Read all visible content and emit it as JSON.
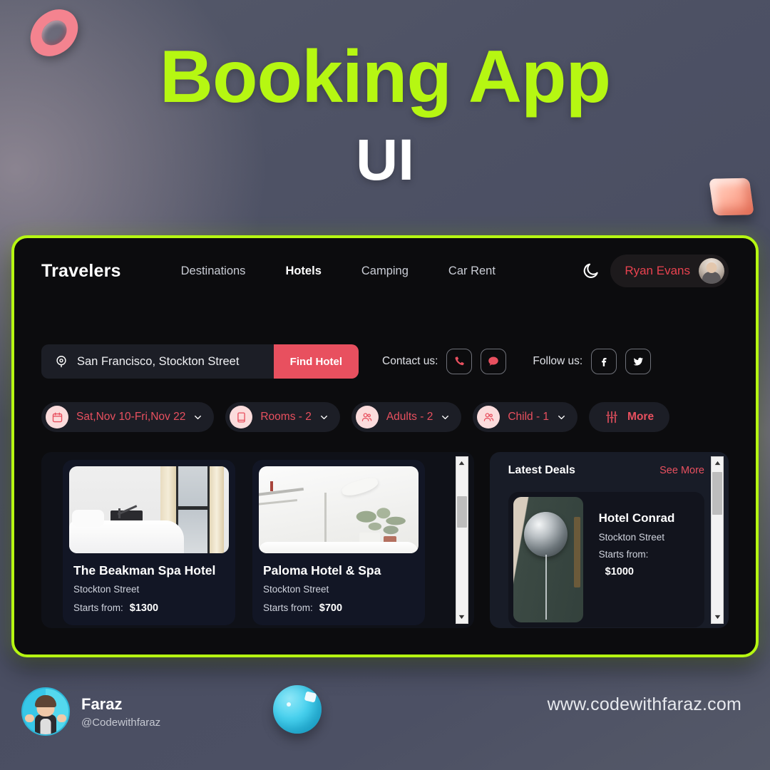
{
  "poster": {
    "headline_line1": "Booking App",
    "headline_line2": "UI",
    "colors": {
      "neon": "#b6f712",
      "accent_red": "#e8505f",
      "panel_dark": "#0c0c0e",
      "card_navy": "#121625",
      "background": "#4b4f63"
    },
    "decor": {
      "torus": "torus-3d-prop",
      "cube": "cube-3d-prop",
      "sphere": "sphere-3d-prop"
    }
  },
  "app": {
    "brand": "Travelers",
    "nav": [
      {
        "label": "Destinations",
        "active": false
      },
      {
        "label": "Hotels",
        "active": true
      },
      {
        "label": "Camping",
        "active": false
      },
      {
        "label": "Car Rent",
        "active": false
      }
    ],
    "theme_toggle_icon": "moon-icon",
    "profile": {
      "name": "Ryan Evans",
      "avatar_icon": "user-avatar"
    },
    "search": {
      "location_icon": "map-pin-icon",
      "value": "San Francisco, Stockton Street",
      "placeholder": "San Francisco, Stockton Street",
      "button_label": "Find Hotel"
    },
    "contact": {
      "label": "Contact us:",
      "icons": [
        "phone-icon",
        "chat-icon"
      ]
    },
    "follow": {
      "label": "Follow us:",
      "icons": [
        "facebook-icon",
        "twitter-icon"
      ]
    },
    "filters": [
      {
        "icon": "calendar-icon",
        "label": "Sat,Nov 10-Fri,Nov 22",
        "caret": true
      },
      {
        "icon": "room-icon",
        "label": "Rooms - 2",
        "caret": true
      },
      {
        "icon": "adults-icon",
        "label": "Adults - 2",
        "caret": true
      },
      {
        "icon": "child-icon",
        "label": "Child - 1",
        "caret": true
      },
      {
        "icon": "sliders-icon",
        "label": "More",
        "caret": false
      }
    ],
    "hotels": [
      {
        "name": "The Beakman Spa Hotel",
        "street": "Stockton Street",
        "price_label": "Starts from:",
        "price": "$1300",
        "photo": "bedroom-window-photo"
      },
      {
        "name": "Paloma Hotel & Spa",
        "street": "Stockton Street",
        "price_label": "Starts from:",
        "price": "$700",
        "photo": "white-room-plants-photo"
      }
    ],
    "deals": {
      "title": "Latest Deals",
      "see_more": "See More",
      "item": {
        "name": "Hotel Conrad",
        "street": "Stockton Street",
        "price_label": "Starts from:",
        "price": "$1000",
        "photo": "silver-balloon-photo"
      }
    },
    "scrollbars": {
      "up_icon": "caret-up-icon",
      "down_icon": "caret-down-icon"
    }
  },
  "footer": {
    "author_name": "Faraz",
    "author_handle": "@Codewithfaraz",
    "website": "www.codewithfaraz.com"
  }
}
